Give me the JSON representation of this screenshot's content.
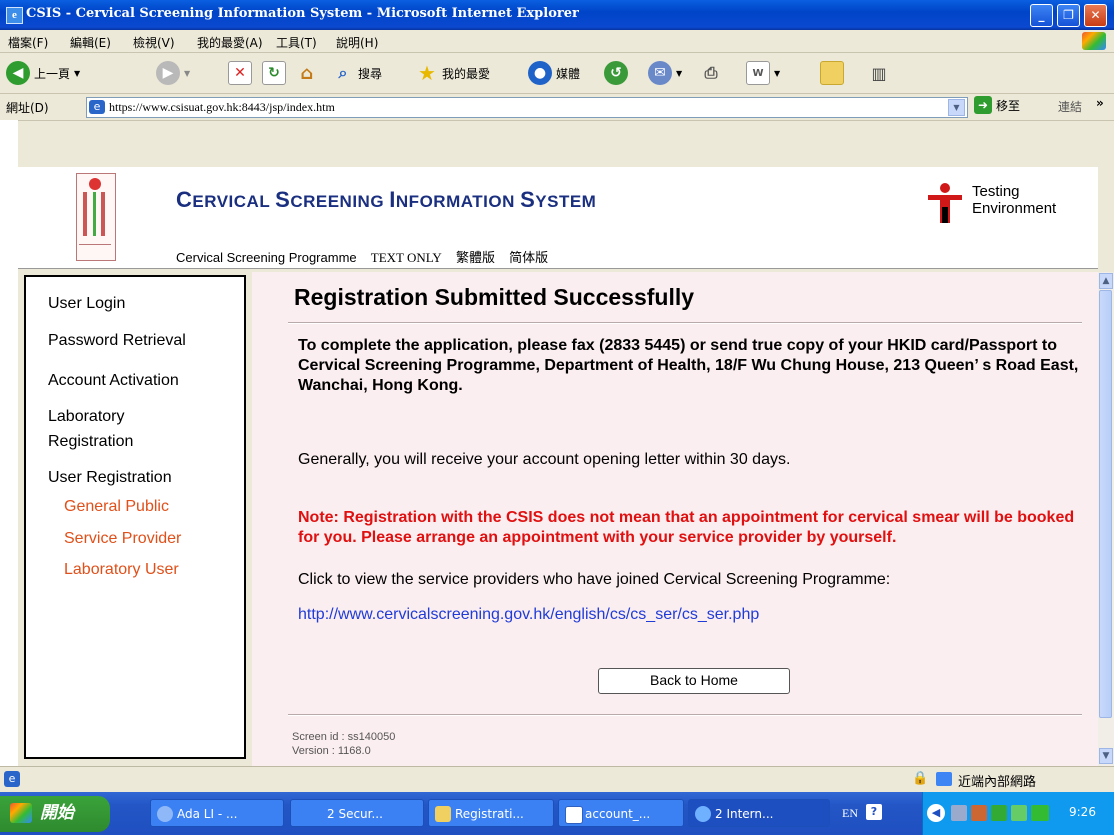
{
  "window": {
    "title": "CSIS - Cervical Screening Information System - Microsoft Internet Explorer",
    "app_icon": "e"
  },
  "menubar": [
    "檔案(F)",
    "編輯(E)",
    "檢視(V)",
    "我的最愛(A)",
    "工具(T)",
    "說明(H)"
  ],
  "toolbar": {
    "back_label": "上一頁",
    "search_label": "搜尋",
    "favorites_label": "我的最愛",
    "media_label": "媒體"
  },
  "addressbar": {
    "label": "網址(D)",
    "url": "https://www.csisuat.gov.hk:8443/jsp/index.htm",
    "go_label": "移至",
    "links_label": "連結"
  },
  "header": {
    "system_title_first": [
      "C",
      "ERVICAL ",
      "S",
      "CREENING ",
      "I",
      "NFORMATION ",
      "S",
      "YSTEM"
    ],
    "nav": [
      "Cervical Screening Programme",
      "TEXT ONLY",
      "繁體版",
      "简体版"
    ],
    "testing_line1": "Testing",
    "testing_line2": "Environment"
  },
  "sidebar": {
    "items": [
      {
        "label": "User Login"
      },
      {
        "label": "Password Retrieval"
      },
      {
        "label": "Account Activation"
      },
      {
        "label": "Laboratory"
      },
      {
        "label": "Registration"
      },
      {
        "label": "User Registration"
      }
    ],
    "sub_items": [
      {
        "label": "General Public"
      },
      {
        "label": "Service Provider"
      },
      {
        "label": "Laboratory User"
      }
    ]
  },
  "main": {
    "heading": "Registration Submitted Successfully",
    "instruction": "To complete the application, please fax (2833 5445) or send true copy of your HKID card/Passport to Cervical Screening Programme, Department of Health, 18/F Wu Chung House, 213 Queen’ s Road East, Wanchai, Hong Kong.",
    "generally": "Generally, you will receive your account opening letter within 30 days.",
    "note": "Note: Registration with the CSIS does not mean that an appointment for cervical smear will be booked for you. Please arrange an appointment with your service provider by yourself.",
    "click_text": "Click to view the service providers who have joined Cervical Screening Programme:",
    "link": "http://www.cervicalscreening.gov.hk/english/cs/cs_ser/cs_ser.php",
    "back_button": "Back to Home",
    "screen_id": "Screen id : ss140050",
    "version": "Version : 1168.0"
  },
  "statusbar": {
    "zone": "近端內部網路"
  },
  "taskbar": {
    "start": "開始",
    "tasks": [
      "Ada LI - ...",
      "2 Secur...",
      "Registrati...",
      "account_...",
      "2 Intern..."
    ],
    "lang": "EN",
    "clock": "9:26"
  },
  "colors": {
    "accent_blue": "#1a2f80",
    "note_red": "#e01010",
    "sub_item_orange": "#e0501a",
    "main_bg": "#fbeef0"
  }
}
